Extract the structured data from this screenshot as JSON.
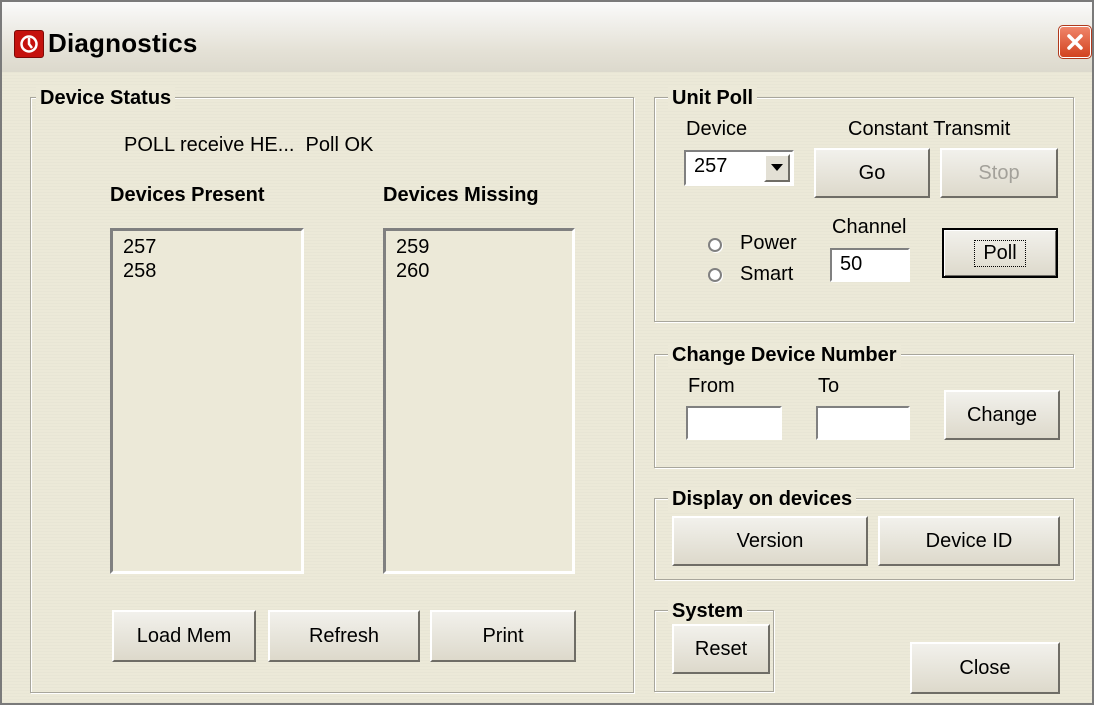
{
  "window": {
    "title": "Diagnostics"
  },
  "device_status": {
    "group_label": "Device Status",
    "status_text": "POLL receive HE...  Poll OK",
    "present_header": "Devices Present",
    "missing_header": "Devices Missing",
    "present_items": [
      "257",
      "258"
    ],
    "missing_items": [
      "259",
      "260"
    ],
    "buttons": {
      "load_mem": "Load Mem",
      "refresh": "Refresh",
      "print": "Print"
    }
  },
  "unit_poll": {
    "group_label": "Unit Poll",
    "device_label": "Device",
    "device_value": "257",
    "constant_transmit_label": "Constant Transmit",
    "go_label": "Go",
    "stop_label": "Stop",
    "channel_label": "Channel",
    "channel_value": "50",
    "power_label": "Power",
    "smart_label": "Smart",
    "poll_label": "Poll"
  },
  "change_device_number": {
    "group_label": "Change Device Number",
    "from_label": "From",
    "to_label": "To",
    "from_value": "",
    "to_value": "",
    "change_label": "Change"
  },
  "display_on_devices": {
    "group_label": "Display on devices",
    "version_label": "Version",
    "device_id_label": "Device ID"
  },
  "system": {
    "group_label": "System",
    "reset_label": "Reset"
  },
  "close_label": "Close",
  "colors": {
    "close_button": "#d2421f",
    "app_icon": "#c5120e",
    "background": "#ece9d8"
  }
}
